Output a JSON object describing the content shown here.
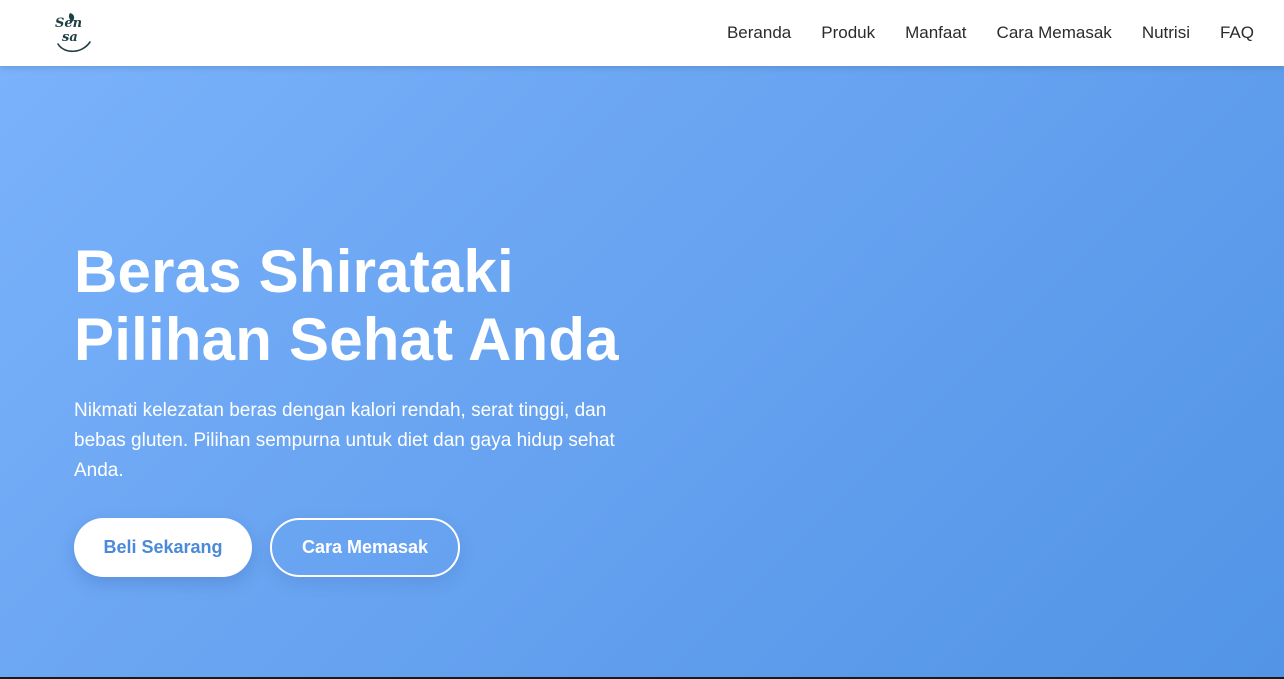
{
  "brand": {
    "logo_top": "Sen",
    "logo_bottom": "sa",
    "logo_color": "#1f3f46",
    "leaf_color": "#1f3f46"
  },
  "nav": {
    "items": [
      {
        "label": "Beranda"
      },
      {
        "label": "Produk"
      },
      {
        "label": "Manfaat"
      },
      {
        "label": "Cara Memasak"
      },
      {
        "label": "Nutrisi"
      },
      {
        "label": "FAQ"
      }
    ]
  },
  "hero": {
    "title_line1": "Beras Shirataki",
    "title_line2": "Pilihan Sehat Anda",
    "description": "Nikmati kelezatan beras dengan kalori rendah, serat tinggi, dan bebas gluten. Pilihan sempurna untuk diet dan gaya hidup sehat Anda.",
    "primary_button": "Beli Sekarang",
    "secondary_button": "Cara Memasak",
    "gradient_start": "#7ab2fb",
    "gradient_end": "#5294e6",
    "primary_button_text_color": "#4a8ad8"
  }
}
